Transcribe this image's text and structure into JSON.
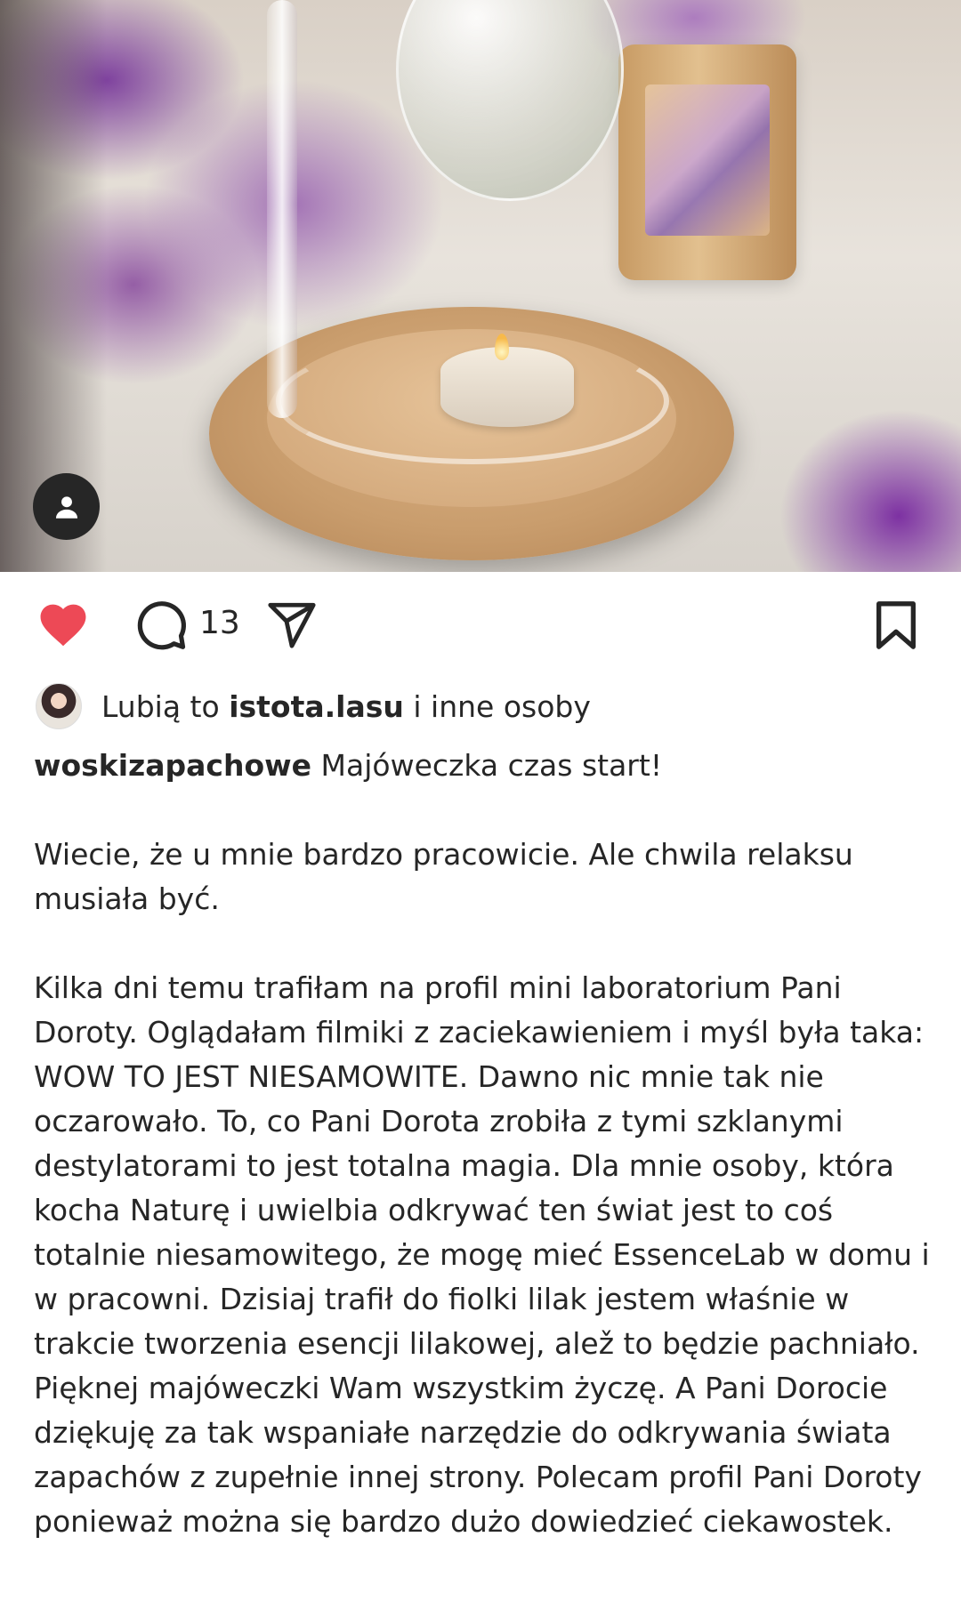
{
  "post": {
    "image_alt": "Szklany destylator z lilakiem i świeczką",
    "comment_count": "13",
    "liked": true,
    "likes": {
      "prefix": "Lubią to",
      "user": "istota.lasu",
      "suffix": "i inne osoby"
    },
    "caption": {
      "username": "woskizapachowe",
      "first_line": "Majóweczka czas start!",
      "paragraph_2": "Wiecie, że u mnie bardzo pracowicie. Ale chwila relaksu musiała być.",
      "paragraph_3": "Kilka dni temu trafiłam na profil mini laboratorium Pani Doroty. Oglądałam filmiki z zaciekawieniem i myśl była taka: WOW TO JEST NIESAMOWITE. Dawno nic mnie tak nie oczarowało. To, co Pani Dorota zrobiła z tymi szklanymi destylatorami to jest totalna magia. Dla mnie osoby, która kocha Naturę i uwielbia odkrywać ten świat jest to coś totalnie niesamowitego, że mogę mieć EssenceLab w domu i w pracowni. Dzisiaj trafił do fiolki lilak jestem właśnie w trakcie tworzenia esencji lilakowej, alež to będzie pachniało. Pięknej majóweczki Wam wszystkim życzę. A Pani Dorocie dziękuję za tak wspaniałe narzędzie do odkrywania świata zapachów z zupełnie innej strony. Polecam profil Pani Doroty ponieważ można się bardzo dużo dowiedzieć ciekawostek."
    }
  },
  "icons": {
    "tag": "user-tag-icon",
    "like": "heart-icon",
    "comment": "comment-icon",
    "share": "send-icon",
    "save": "bookmark-icon"
  },
  "colors": {
    "like": "#ed4956",
    "text": "#262626",
    "background": "#ffffff"
  }
}
